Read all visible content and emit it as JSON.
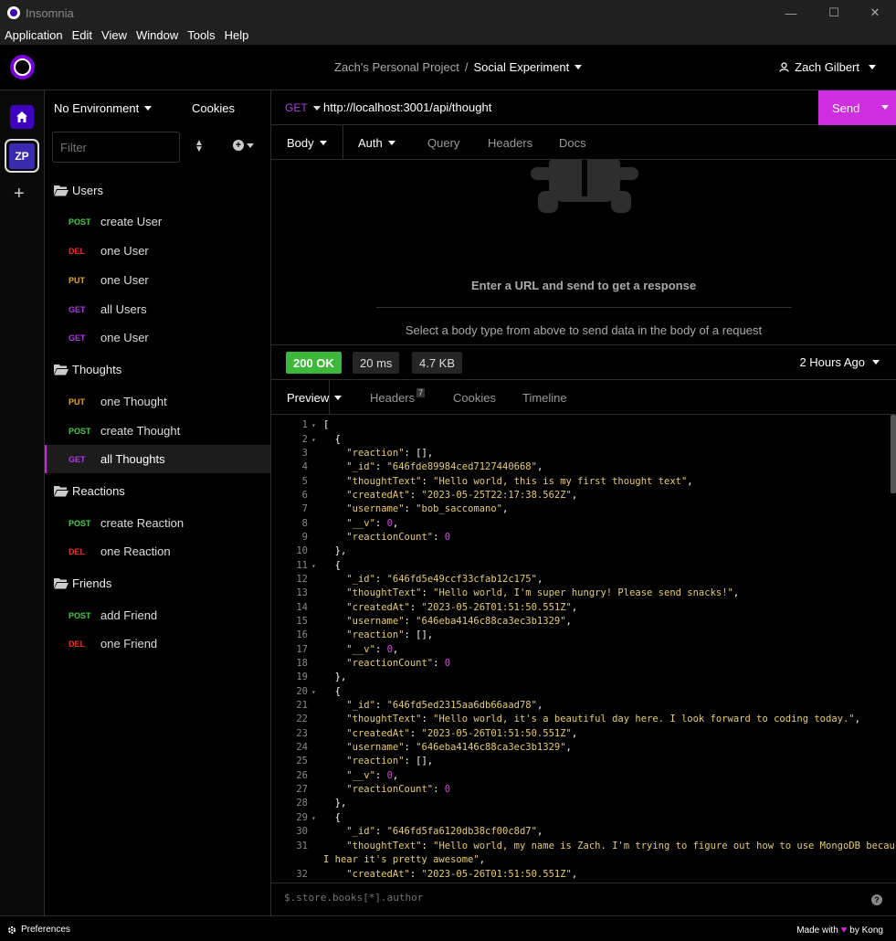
{
  "window": {
    "title": "Insomnia",
    "minimize": "—",
    "maximize": "☐",
    "close": "✕"
  },
  "menu": [
    "Application",
    "Edit",
    "View",
    "Window",
    "Tools",
    "Help"
  ],
  "header": {
    "project": "Zach's Personal Project",
    "separator": "/",
    "workspace": "Social Experiment",
    "user": "Zach Gilbert"
  },
  "rail": {
    "org_initials": "ZP",
    "add": "+"
  },
  "sidebar": {
    "environment": "No Environment",
    "cookies": "Cookies",
    "filter_placeholder": "Filter",
    "folders": [
      {
        "name": "Users",
        "requests": [
          {
            "method": "POST",
            "name": "create User"
          },
          {
            "method": "DEL",
            "name": "one User"
          },
          {
            "method": "PUT",
            "name": "one User"
          },
          {
            "method": "GET",
            "name": "all Users"
          },
          {
            "method": "GET",
            "name": "one User"
          }
        ]
      },
      {
        "name": "Thoughts",
        "requests": [
          {
            "method": "PUT",
            "name": "one Thought"
          },
          {
            "method": "POST",
            "name": "create Thought"
          },
          {
            "method": "GET",
            "name": "all Thoughts",
            "active": true
          }
        ]
      },
      {
        "name": "Reactions",
        "requests": [
          {
            "method": "POST",
            "name": "create Reaction"
          },
          {
            "method": "DEL",
            "name": "one Reaction"
          }
        ]
      },
      {
        "name": "Friends",
        "requests": [
          {
            "method": "POST",
            "name": "add Friend"
          },
          {
            "method": "DEL",
            "name": "one Friend"
          }
        ]
      }
    ]
  },
  "request": {
    "method": "GET",
    "url": "http://localhost:3001/api/thought",
    "send": "Send",
    "tabs": {
      "body": "Body",
      "auth": "Auth",
      "query": "Query",
      "headers": "Headers",
      "docs": "Docs"
    },
    "empty_hint": "Enter a URL and send to get a response",
    "body_hint": "Select a body type from above to send data in the body of a request"
  },
  "response": {
    "status": "200 OK",
    "time": "20 ms",
    "size": "4.7 KB",
    "ago": "2 Hours Ago",
    "tabs": {
      "preview": "Preview",
      "headers": "Headers",
      "headers_count": "7",
      "cookies": "Cookies",
      "timeline": "Timeline"
    },
    "filter_placeholder": "$.store.books[*].author",
    "help": "?"
  },
  "code_lines": [
    {
      "n": "1",
      "fold": true,
      "parts": [
        [
          "p",
          "["
        ]
      ]
    },
    {
      "n": "2",
      "fold": true,
      "parts": [
        [
          "p",
          "  {"
        ]
      ]
    },
    {
      "n": "3",
      "parts": [
        [
          "p",
          "    "
        ],
        [
          "k",
          "\"reaction\""
        ],
        [
          "p",
          ": [],"
        ]
      ]
    },
    {
      "n": "4",
      "parts": [
        [
          "p",
          "    "
        ],
        [
          "k",
          "\"_id\""
        ],
        [
          "p",
          ": "
        ],
        [
          "s",
          "\"646fde89984ced7127440668\""
        ],
        [
          "p",
          ","
        ]
      ]
    },
    {
      "n": "5",
      "parts": [
        [
          "p",
          "    "
        ],
        [
          "k",
          "\"thoughtText\""
        ],
        [
          "p",
          ": "
        ],
        [
          "s",
          "\"Hello world, this is my first thought text\""
        ],
        [
          "p",
          ","
        ]
      ]
    },
    {
      "n": "6",
      "parts": [
        [
          "p",
          "    "
        ],
        [
          "k",
          "\"createdAt\""
        ],
        [
          "p",
          ": "
        ],
        [
          "s",
          "\"2023-05-25T22:17:38.562Z\""
        ],
        [
          "p",
          ","
        ]
      ]
    },
    {
      "n": "7",
      "parts": [
        [
          "p",
          "    "
        ],
        [
          "k",
          "\"username\""
        ],
        [
          "p",
          ": "
        ],
        [
          "s",
          "\"bob_saccomano\""
        ],
        [
          "p",
          ","
        ]
      ]
    },
    {
      "n": "8",
      "parts": [
        [
          "p",
          "    "
        ],
        [
          "k",
          "\"__v\""
        ],
        [
          "p",
          ": "
        ],
        [
          "n",
          "0"
        ],
        [
          "p",
          ","
        ]
      ]
    },
    {
      "n": "9",
      "parts": [
        [
          "p",
          "    "
        ],
        [
          "k",
          "\"reactionCount\""
        ],
        [
          "p",
          ": "
        ],
        [
          "n",
          "0"
        ]
      ]
    },
    {
      "n": "10",
      "parts": [
        [
          "p",
          "  },"
        ]
      ]
    },
    {
      "n": "11",
      "fold": true,
      "parts": [
        [
          "p",
          "  {"
        ]
      ]
    },
    {
      "n": "12",
      "parts": [
        [
          "p",
          "    "
        ],
        [
          "k",
          "\"_id\""
        ],
        [
          "p",
          ": "
        ],
        [
          "s",
          "\"646fd5e49ccf33cfab12c175\""
        ],
        [
          "p",
          ","
        ]
      ]
    },
    {
      "n": "13",
      "parts": [
        [
          "p",
          "    "
        ],
        [
          "k",
          "\"thoughtText\""
        ],
        [
          "p",
          ": "
        ],
        [
          "s",
          "\"Hello world, I'm super hungry! Please send snacks!\""
        ],
        [
          "p",
          ","
        ]
      ]
    },
    {
      "n": "14",
      "parts": [
        [
          "p",
          "    "
        ],
        [
          "k",
          "\"createdAt\""
        ],
        [
          "p",
          ": "
        ],
        [
          "s",
          "\"2023-05-26T01:51:50.551Z\""
        ],
        [
          "p",
          ","
        ]
      ]
    },
    {
      "n": "15",
      "parts": [
        [
          "p",
          "    "
        ],
        [
          "k",
          "\"username\""
        ],
        [
          "p",
          ": "
        ],
        [
          "s",
          "\"646eba4146c88ca3ec3b1329\""
        ],
        [
          "p",
          ","
        ]
      ]
    },
    {
      "n": "16",
      "parts": [
        [
          "p",
          "    "
        ],
        [
          "k",
          "\"reaction\""
        ],
        [
          "p",
          ": [],"
        ]
      ]
    },
    {
      "n": "17",
      "parts": [
        [
          "p",
          "    "
        ],
        [
          "k",
          "\"__v\""
        ],
        [
          "p",
          ": "
        ],
        [
          "n",
          "0"
        ],
        [
          "p",
          ","
        ]
      ]
    },
    {
      "n": "18",
      "parts": [
        [
          "p",
          "    "
        ],
        [
          "k",
          "\"reactionCount\""
        ],
        [
          "p",
          ": "
        ],
        [
          "n",
          "0"
        ]
      ]
    },
    {
      "n": "19",
      "parts": [
        [
          "p",
          "  },"
        ]
      ]
    },
    {
      "n": "20",
      "fold": true,
      "parts": [
        [
          "p",
          "  {"
        ]
      ]
    },
    {
      "n": "21",
      "parts": [
        [
          "p",
          "    "
        ],
        [
          "k",
          "\"_id\""
        ],
        [
          "p",
          ": "
        ],
        [
          "s",
          "\"646fd5ed2315aa6db66aad78\""
        ],
        [
          "p",
          ","
        ]
      ]
    },
    {
      "n": "22",
      "parts": [
        [
          "p",
          "    "
        ],
        [
          "k",
          "\"thoughtText\""
        ],
        [
          "p",
          ": "
        ],
        [
          "s",
          "\"Hello world, it's a beautiful day here. I look forward to coding today.\""
        ],
        [
          "p",
          ","
        ]
      ]
    },
    {
      "n": "23",
      "parts": [
        [
          "p",
          "    "
        ],
        [
          "k",
          "\"createdAt\""
        ],
        [
          "p",
          ": "
        ],
        [
          "s",
          "\"2023-05-26T01:51:50.551Z\""
        ],
        [
          "p",
          ","
        ]
      ]
    },
    {
      "n": "24",
      "parts": [
        [
          "p",
          "    "
        ],
        [
          "k",
          "\"username\""
        ],
        [
          "p",
          ": "
        ],
        [
          "s",
          "\"646eba4146c88ca3ec3b1329\""
        ],
        [
          "p",
          ","
        ]
      ]
    },
    {
      "n": "25",
      "parts": [
        [
          "p",
          "    "
        ],
        [
          "k",
          "\"reaction\""
        ],
        [
          "p",
          ": [],"
        ]
      ]
    },
    {
      "n": "26",
      "parts": [
        [
          "p",
          "    "
        ],
        [
          "k",
          "\"__v\""
        ],
        [
          "p",
          ": "
        ],
        [
          "n",
          "0"
        ],
        [
          "p",
          ","
        ]
      ]
    },
    {
      "n": "27",
      "parts": [
        [
          "p",
          "    "
        ],
        [
          "k",
          "\"reactionCount\""
        ],
        [
          "p",
          ": "
        ],
        [
          "n",
          "0"
        ]
      ]
    },
    {
      "n": "28",
      "parts": [
        [
          "p",
          "  },"
        ]
      ]
    },
    {
      "n": "29",
      "fold": true,
      "parts": [
        [
          "p",
          "  {"
        ]
      ]
    },
    {
      "n": "30",
      "parts": [
        [
          "p",
          "    "
        ],
        [
          "k",
          "\"_id\""
        ],
        [
          "p",
          ": "
        ],
        [
          "s",
          "\"646fd5fa6120db38cf00c8d7\""
        ],
        [
          "p",
          ","
        ]
      ]
    },
    {
      "n": "31",
      "parts": [
        [
          "p",
          "    "
        ],
        [
          "k",
          "\"thoughtText\""
        ],
        [
          "p",
          ": "
        ],
        [
          "s",
          "\"Hello world, my name is Zach. I'm trying to figure out how to use MongoDB because"
        ]
      ]
    },
    {
      "n": "",
      "parts": [
        [
          "s",
          "I hear it's pretty awesome\""
        ],
        [
          "p",
          ","
        ]
      ]
    },
    {
      "n": "32",
      "parts": [
        [
          "p",
          "    "
        ],
        [
          "k",
          "\"createdAt\""
        ],
        [
          "p",
          ": "
        ],
        [
          "s",
          "\"2023-05-26T01:51:50.551Z\""
        ],
        [
          "p",
          ","
        ]
      ]
    }
  ],
  "footer": {
    "preferences": "Preferences",
    "made_with": "Made with",
    "by": "by Kong"
  },
  "colors": {
    "accent": "#cf2de0",
    "brand": "#4000bf",
    "ok": "#3db83a",
    "post": "#4cc94c",
    "del": "#e0302f",
    "put": "#e0a82e",
    "get": "#b13be3"
  }
}
